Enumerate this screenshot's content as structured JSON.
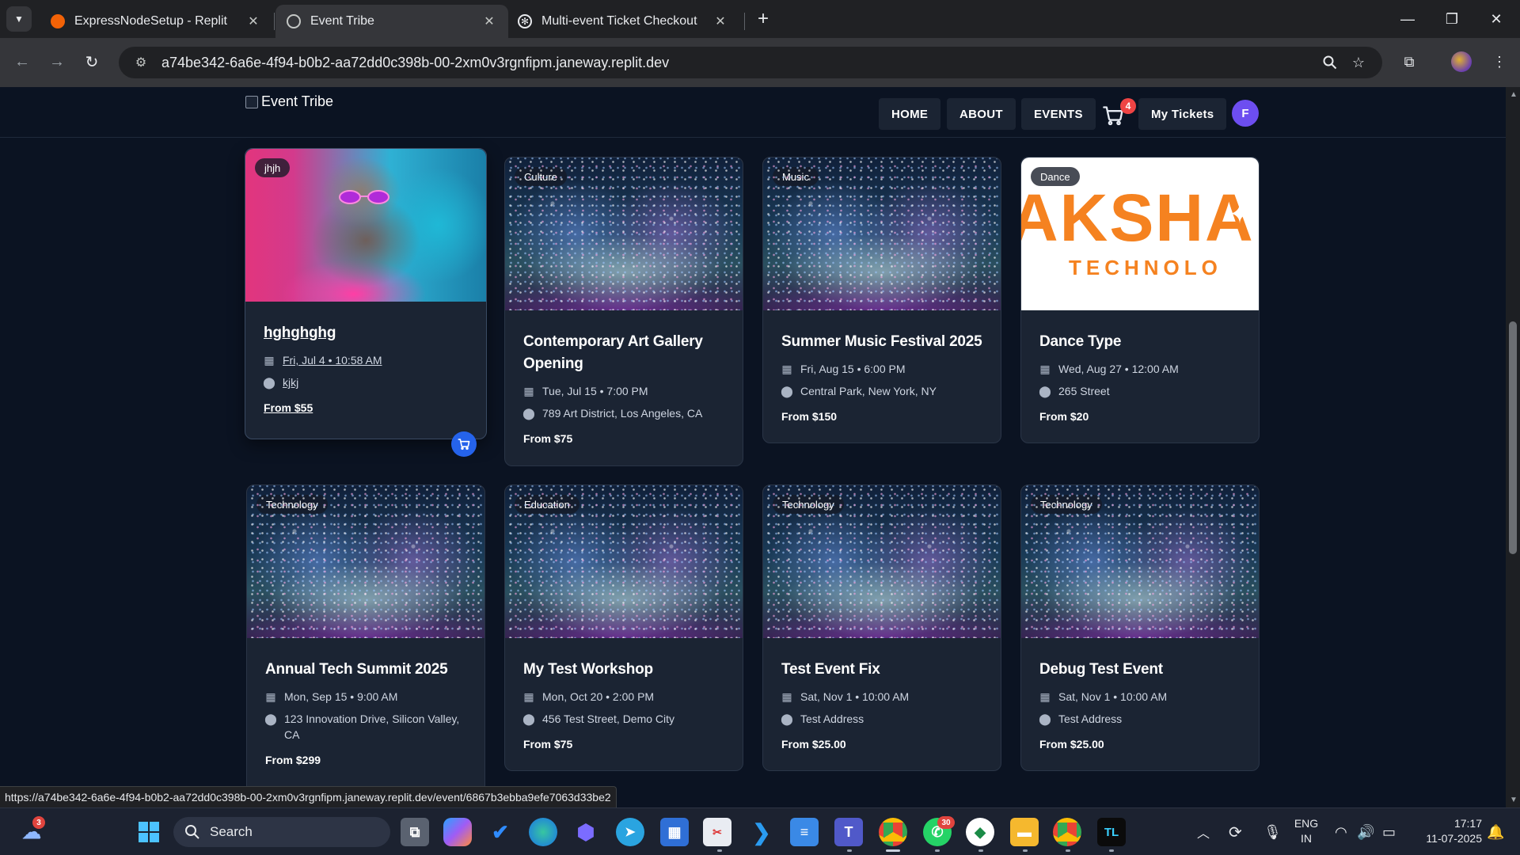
{
  "browser": {
    "tabs": [
      {
        "title": "ExpressNodeSetup - Replit",
        "icon": "replit-icon"
      },
      {
        "title": "Event Tribe",
        "icon": "globe-icon"
      },
      {
        "title": "Multi-event Ticket Checkout",
        "icon": "openai-icon"
      }
    ],
    "url": "a74be342-6a6e-4f94-b0b2-aa72dd0c398b-00-2xm0v3rgnfipm.janeway.replit.dev",
    "status_url": "https://a74be342-6a6e-4f94-b0b2-aa72dd0c398b-00-2xm0v3rgnfipm.janeway.replit.dev/event/6867b3ebba9efe7063d33be2"
  },
  "site": {
    "brand_alt": "Event Tribe",
    "nav": {
      "home": "HOME",
      "about": "ABOUT",
      "events": "EVENTS",
      "my_tickets": "My Tickets"
    },
    "cart_count": "4",
    "avatar_initial": "F",
    "accent": "#2563eb",
    "avatar_color": "#6d4ef0"
  },
  "events": [
    {
      "tag": "jhjh",
      "title": "hghghghg",
      "date": "Fri, Jul 4 • 10:58 AM",
      "location": "kjkj",
      "price": "From $55",
      "image": "cat"
    },
    {
      "tag": "Culture",
      "title": "Contemporary Art Gallery Opening",
      "date": "Tue, Jul 15 • 7:00 PM",
      "location": "789 Art District, Los Angeles, CA",
      "price": "From $75",
      "image": "confetti"
    },
    {
      "tag": "Music",
      "title": "Summer Music Festival 2025",
      "date": "Fri, Aug 15 • 6:00 PM",
      "location": "Central Park, New York, NY",
      "price": "From $150",
      "image": "confetti"
    },
    {
      "tag": "Dance",
      "title": "Dance Type",
      "date": "Wed, Aug 27 • 12:00 AM",
      "location": "265 Street",
      "price": "From $20",
      "image": "logo",
      "logo_text": "AKSHA",
      "logo_sub": "TECHNOLO"
    },
    {
      "tag": "Technology",
      "title": "Annual Tech Summit 2025",
      "date": "Mon, Sep 15 • 9:00 AM",
      "location": "123 Innovation Drive, Silicon Valley, CA",
      "price": "From $299",
      "image": "confetti"
    },
    {
      "tag": "Education",
      "title": "My Test Workshop",
      "date": "Mon, Oct 20 • 2:00 PM",
      "location": "456 Test Street, Demo City",
      "price": "From $75",
      "image": "confetti"
    },
    {
      "tag": "Technology",
      "title": "Test Event Fix",
      "date": "Sat, Nov 1 • 10:00 AM",
      "location": "Test Address",
      "price": "From $25.00",
      "image": "confetti"
    },
    {
      "tag": "Technology",
      "title": "Debug Test Event",
      "date": "Sat, Nov 1 • 10:00 AM",
      "location": "Test Address",
      "price": "From $25.00",
      "image": "confetti"
    }
  ],
  "taskbar": {
    "search_label": "Search",
    "weather_badge": "3",
    "whatsapp_badge": "30",
    "lang_line1": "ENG",
    "lang_line2": "IN",
    "time": "17:17",
    "date": "11-07-2025"
  }
}
